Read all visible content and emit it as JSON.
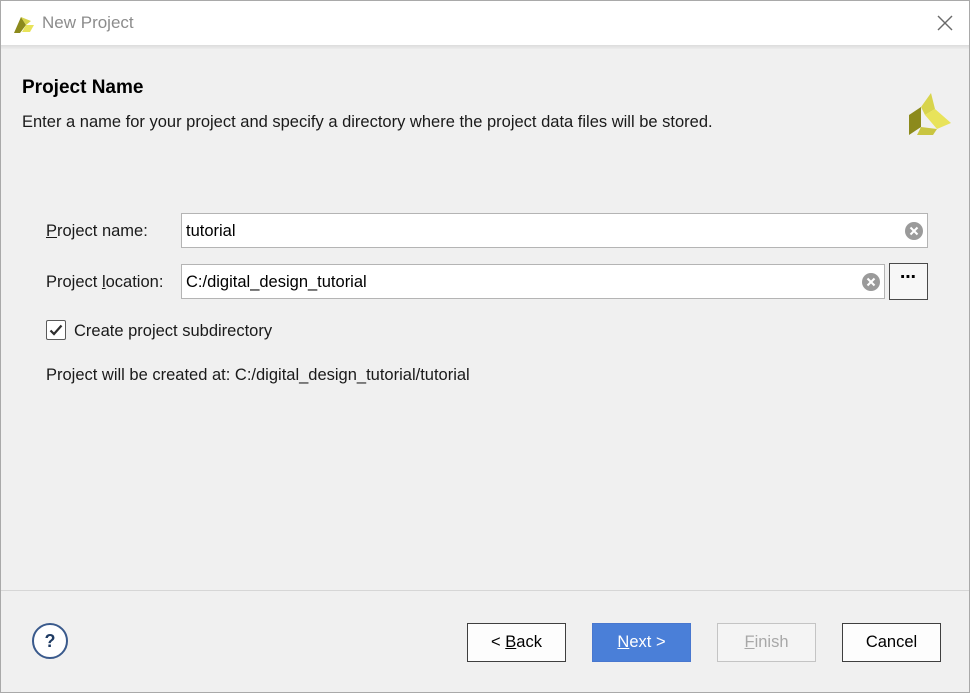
{
  "window": {
    "title": "New Project",
    "icons": {
      "app": "xilinx-logo-icon",
      "close": "close-icon"
    }
  },
  "header": {
    "title": "Project Name",
    "description": "Enter a name for your project and specify a directory where the project data files will be stored.",
    "logo_icon": "xilinx-logo-icon"
  },
  "form": {
    "project_name": {
      "label_mnemonic": "P",
      "label_rest": "roject name:",
      "value": "tutorial"
    },
    "project_location": {
      "label_before": "Project ",
      "label_mnemonic": "l",
      "label_after": "ocation:",
      "value": "C:/digital_design_tutorial",
      "browse_label": "⋯"
    },
    "create_subdirectory": {
      "label": "Create project subdirectory",
      "checked": true
    },
    "created_at_text": "Project will be created at: C:/digital_design_tutorial/tutorial"
  },
  "footer": {
    "help_label": "?",
    "back_prefix": "< ",
    "back_mnemonic": "B",
    "back_rest": "ack",
    "next_mnemonic": "N",
    "next_rest": "ext >",
    "finish_mnemonic": "F",
    "finish_rest": "inish",
    "cancel_label": "Cancel"
  },
  "colors": {
    "accent": "#4a7fd8",
    "logo_yellow": "#e8e35a",
    "logo_olive": "#8c8a1c",
    "disabled_text": "#a8a8a8"
  }
}
